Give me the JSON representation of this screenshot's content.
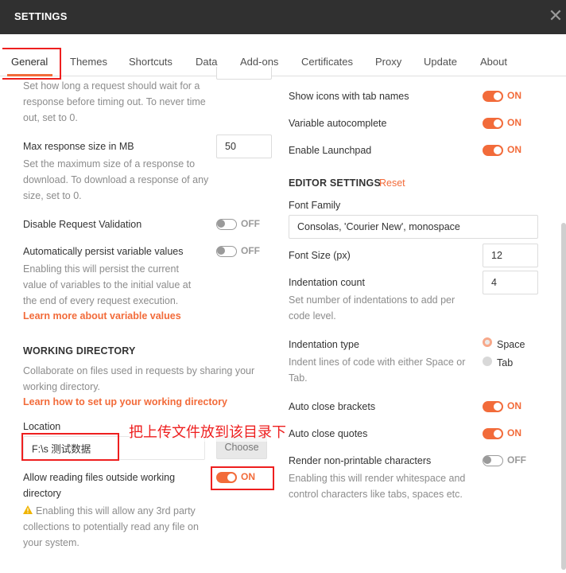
{
  "window": {
    "title": "SETTINGS"
  },
  "tabs": [
    {
      "label": "General"
    },
    {
      "label": "Themes"
    },
    {
      "label": "Shortcuts"
    },
    {
      "label": "Data"
    },
    {
      "label": "Add-ons"
    },
    {
      "label": "Certificates"
    },
    {
      "label": "Proxy"
    },
    {
      "label": "Update"
    },
    {
      "label": "About"
    }
  ],
  "left": {
    "timeout_help": "Set how long a request should wait for a response before timing out. To never time out, set to 0.",
    "max_response": {
      "label": "Max response size in MB",
      "value": "50",
      "help": "Set the maximum size of a response to download. To download a response of any size, set to 0."
    },
    "disable_validation": {
      "label": "Disable Request Validation",
      "state": "OFF"
    },
    "persist_vars": {
      "label": "Automatically persist variable values",
      "state": "OFF",
      "help": "Enabling this will persist the current value of variables to the initial value at the end of every request execution.",
      "link": "Learn more about variable values"
    },
    "working_dir": {
      "header": "WORKING DIRECTORY",
      "help": "Collaborate on files used in requests by sharing your working directory.",
      "link": "Learn how to set up your working directory",
      "location_label": "Location",
      "location_value": "F:\\s  测试数据",
      "choose_label": "Choose",
      "allow_label": "Allow reading files outside working directory",
      "allow_state": "ON",
      "warning": "Enabling this will allow any 3rd party collections to potentially read any file on your system."
    }
  },
  "right": {
    "show_icons": {
      "label": "Show icons with tab names",
      "state": "ON"
    },
    "var_autocomplete": {
      "label": "Variable autocomplete",
      "state": "ON"
    },
    "launchpad": {
      "label": "Enable Launchpad",
      "state": "ON"
    },
    "editor": {
      "header": "EDITOR SETTINGS",
      "reset": "Reset",
      "font_family_label": "Font Family",
      "font_family_value": "Consolas, 'Courier New', monospace",
      "font_size_label": "Font Size (px)",
      "font_size_value": "12",
      "indent_count_label": "Indentation count",
      "indent_count_value": "4",
      "indent_count_help": "Set number of indentations to add per code level.",
      "indent_type_label": "Indentation type",
      "indent_type_help": "Indent lines of code with either Space or Tab.",
      "indent_space": "Space",
      "indent_tab": "Tab",
      "auto_brackets": {
        "label": "Auto close brackets",
        "state": "ON"
      },
      "auto_quotes": {
        "label": "Auto close quotes",
        "state": "ON"
      },
      "render_np": {
        "label": "Render non-printable characters",
        "state": "OFF",
        "help": "Enabling this will render whitespace and control characters like tabs, spaces etc."
      }
    }
  },
  "annotation": {
    "text": "把上传文件放到该目录下",
    "color": "#ee1f1f"
  },
  "colors": {
    "accent": "#f26b3a",
    "titlebar": "#303030"
  },
  "icons": {
    "close": "close-icon",
    "warning": "warning-icon"
  }
}
